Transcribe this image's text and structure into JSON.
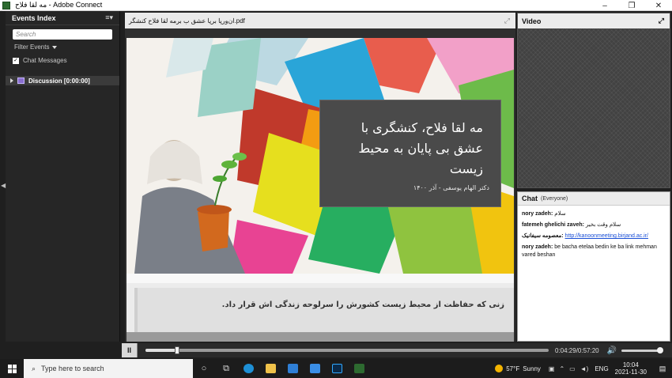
{
  "window": {
    "title": "مه لقا فلاح - Adobe Connect",
    "controls": [
      "–",
      "❐",
      "✕"
    ]
  },
  "events_index": {
    "header": "Events Index",
    "menu_icon": "≡▾",
    "search_placeholder": "Search",
    "filter_label": "Filter Events",
    "chat_messages_label": "Chat Messages",
    "chat_messages_checked": true,
    "discussion_label": "Discussion [0:00:00]"
  },
  "share_pod": {
    "filename": "ان‌ورپا برپا عشق ب برمه لقا فلاح کنشگر.pdf",
    "slide_title": "مه لقا فلاح، کنشگری با عشق بی پایان به محیط زیست",
    "slide_author": "دکتر الهام یوسفی - آذر ۱۴۰۰",
    "next_slide_text": "زنی که حفاظت از محیط زیست کشورش را سرلوحه زندگی اش قرار داد."
  },
  "video_pod": {
    "title": "Video"
  },
  "chat_pod": {
    "title": "Chat",
    "scope": "(Everyone)",
    "messages": [
      {
        "who": "nory zadeh:",
        "text": "سلام"
      },
      {
        "who": "fatemeh ghelichi zaveh:",
        "text": "سلام وقت بخیر"
      },
      {
        "who": "معصومه سیفانیک:",
        "text": "http://kanoonmeeting.birjand.ac.ir/"
      },
      {
        "who": "nory zadeh:",
        "text": "be bacha etelaa bedin ke ba link mehman vared beshan"
      }
    ]
  },
  "playback": {
    "pause_icon": "II",
    "time": "0:04:29/0:57:20",
    "progress": 0.078,
    "volume": 1.0
  },
  "taskbar": {
    "search_placeholder": "Type here to search",
    "temperature": "57°F",
    "weather": "Sunny",
    "language": "ENG",
    "time": "10:04",
    "date": "2021-11-30"
  }
}
